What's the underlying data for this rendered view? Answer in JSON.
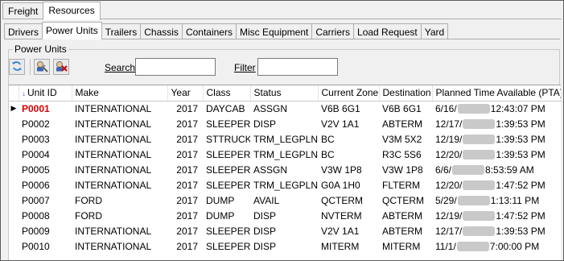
{
  "top_tabs": [
    {
      "label": "Freight"
    },
    {
      "label": "Resources"
    }
  ],
  "sub_tabs": [
    {
      "label": "Drivers"
    },
    {
      "label": "Power Units"
    },
    {
      "label": "Trailers"
    },
    {
      "label": "Chassis"
    },
    {
      "label": "Containers"
    },
    {
      "label": "Misc Equipment"
    },
    {
      "label": "Carriers"
    },
    {
      "label": "Load Request"
    },
    {
      "label": "Yard"
    }
  ],
  "group_title": "Power Units",
  "toolbar": {
    "search_label": "Search",
    "search_value": "",
    "filter_label": "Filter",
    "filter_value": ""
  },
  "columns": [
    "Unit ID",
    "Make",
    "Year",
    "Class",
    "Status",
    "Current Zone",
    "Destination",
    "Planned Time Available (PTA)"
  ],
  "rows": [
    {
      "unit": "P0001",
      "make": "INTERNATIONAL",
      "year": "2017",
      "class": "DAYCAB",
      "status": "ASSGN",
      "zone": "V6B 6G1",
      "dest": "V6B 6G1",
      "pta_date": "6/16/",
      "pta_time": "12:43:07 PM"
    },
    {
      "unit": "P0002",
      "make": "INTERNATIONAL",
      "year": "2017",
      "class": "SLEEPER",
      "status": "DISP",
      "zone": "V2V 1A1",
      "dest": "ABTERM",
      "pta_date": "12/17/",
      "pta_time": "1:39:53 PM"
    },
    {
      "unit": "P0003",
      "make": "INTERNATIONAL",
      "year": "2017",
      "class": "STTRUCK",
      "status": "TRM_LEGPLN",
      "zone": "BC",
      "dest": "V3M 5X2",
      "pta_date": "12/19/",
      "pta_time": "1:39:53 PM"
    },
    {
      "unit": "P0004",
      "make": "INTERNATIONAL",
      "year": "2017",
      "class": "SLEEPER",
      "status": "TRM_LEGPLN",
      "zone": "BC",
      "dest": "R3C 5S6",
      "pta_date": "12/20/",
      "pta_time": "1:39:53 PM"
    },
    {
      "unit": "P0005",
      "make": "INTERNATIONAL",
      "year": "2017",
      "class": "SLEEPER",
      "status": "ASSGN",
      "zone": "V3W 1P8",
      "dest": "V3W 1P8",
      "pta_date": "6/6/",
      "pta_time": "8:53:59 AM"
    },
    {
      "unit": "P0006",
      "make": "INTERNATIONAL",
      "year": "2017",
      "class": "SLEEPER",
      "status": "TRM_LEGPLN",
      "zone": "G0A 1H0",
      "dest": "FLTERM",
      "pta_date": "12/20/",
      "pta_time": "1:47:52 PM"
    },
    {
      "unit": "P0007",
      "make": "FORD",
      "year": "2017",
      "class": "DUMP",
      "status": "AVAIL",
      "zone": "QCTERM",
      "dest": "QCTERM",
      "pta_date": "5/29/",
      "pta_time": "1:13:11 PM"
    },
    {
      "unit": "P0008",
      "make": "FORD",
      "year": "2017",
      "class": "DUMP",
      "status": "DISP",
      "zone": "NVTERM",
      "dest": "ABTERM",
      "pta_date": "12/19/",
      "pta_time": "1:47:52 PM"
    },
    {
      "unit": "P0009",
      "make": "INTERNATIONAL",
      "year": "2017",
      "class": "SLEEPER",
      "status": "DISP",
      "zone": "V2V 1A1",
      "dest": "ABTERM",
      "pta_date": "12/17/",
      "pta_time": "1:39:53 PM"
    },
    {
      "unit": "P0010",
      "make": "INTERNATIONAL",
      "year": "2017",
      "class": "SLEEPER",
      "status": "DISP",
      "zone": "MITERM",
      "dest": "MITERM",
      "pta_date": "11/1/",
      "pta_time": "7:00:00 PM"
    }
  ],
  "colors": {
    "selected_unit": "#d40000",
    "sort_arrow": "#2a5db0"
  },
  "icons": {
    "refresh": "refresh-icon",
    "assign": "assign-resource-icon",
    "remove": "remove-resource-icon"
  }
}
